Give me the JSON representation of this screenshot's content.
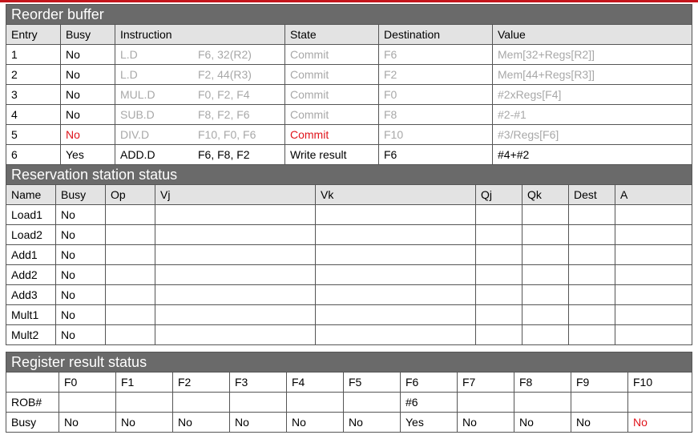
{
  "rob": {
    "title": "Reorder buffer",
    "headers": [
      "Entry",
      "Busy",
      "Instruction",
      "State",
      "Destination",
      "Value"
    ],
    "rows": [
      {
        "entry": "1",
        "busy": "No",
        "op": "L.D",
        "operands": "F6, 32(R2)",
        "state": "Commit",
        "dest": "F6",
        "value": "Mem[32+Regs[R2]]"
      },
      {
        "entry": "2",
        "busy": "No",
        "op": "L.D",
        "operands": "F2, 44(R3)",
        "state": "Commit",
        "dest": "F2",
        "value": "Mem[44+Regs[R3]]"
      },
      {
        "entry": "3",
        "busy": "No",
        "op": "MUL.D",
        "operands": "F0, F2, F4",
        "state": "Commit",
        "dest": "F0",
        "value": "#2xRegs[F4]"
      },
      {
        "entry": "4",
        "busy": "No",
        "op": "SUB.D",
        "operands": "F8, F2, F6",
        "state": "Commit",
        "dest": "F8",
        "value": "#2-#1"
      },
      {
        "entry": "5",
        "busy": "No",
        "op": "DIV.D",
        "operands": "F10, F0, F6",
        "state": "Commit",
        "dest": "F10",
        "value": "#3/Regs[F6]"
      },
      {
        "entry": "6",
        "busy": "Yes",
        "op": "ADD.D",
        "operands": "F6, F8, F2",
        "state": "Write result",
        "dest": "F6",
        "value": "#4+#2"
      }
    ]
  },
  "rs": {
    "title": "Reservation station status",
    "headers": [
      "Name",
      "Busy",
      "Op",
      "Vj",
      "Vk",
      "Qj",
      "Qk",
      "Dest",
      "A"
    ],
    "rows": [
      {
        "name": "Load1",
        "busy": "No"
      },
      {
        "name": "Load2",
        "busy": "No"
      },
      {
        "name": "Add1",
        "busy": "No"
      },
      {
        "name": "Add2",
        "busy": "No"
      },
      {
        "name": "Add3",
        "busy": "No"
      },
      {
        "name": "Mult1",
        "busy": "No"
      },
      {
        "name": "Mult2",
        "busy": "No"
      }
    ]
  },
  "regs": {
    "title": "Register result status",
    "headers": [
      "F0",
      "F1",
      "F2",
      "F3",
      "F4",
      "F5",
      "F6",
      "F7",
      "F8",
      "F9",
      "F10"
    ],
    "rob_label": "ROB#",
    "rob": [
      "",
      "",
      "",
      "",
      "",
      "",
      "#6",
      "",
      "",
      "",
      ""
    ],
    "busy_label": "Busy",
    "busy": [
      "No",
      "No",
      "No",
      "No",
      "No",
      "No",
      "Yes",
      "No",
      "No",
      "No",
      "No"
    ]
  },
  "colors": {
    "highlight": "#e0141b",
    "faded": "#a8a8a8",
    "section_bg": "#6a6a6a",
    "header_bg": "#e3e3e3",
    "accent_line": "#c4161c"
  }
}
